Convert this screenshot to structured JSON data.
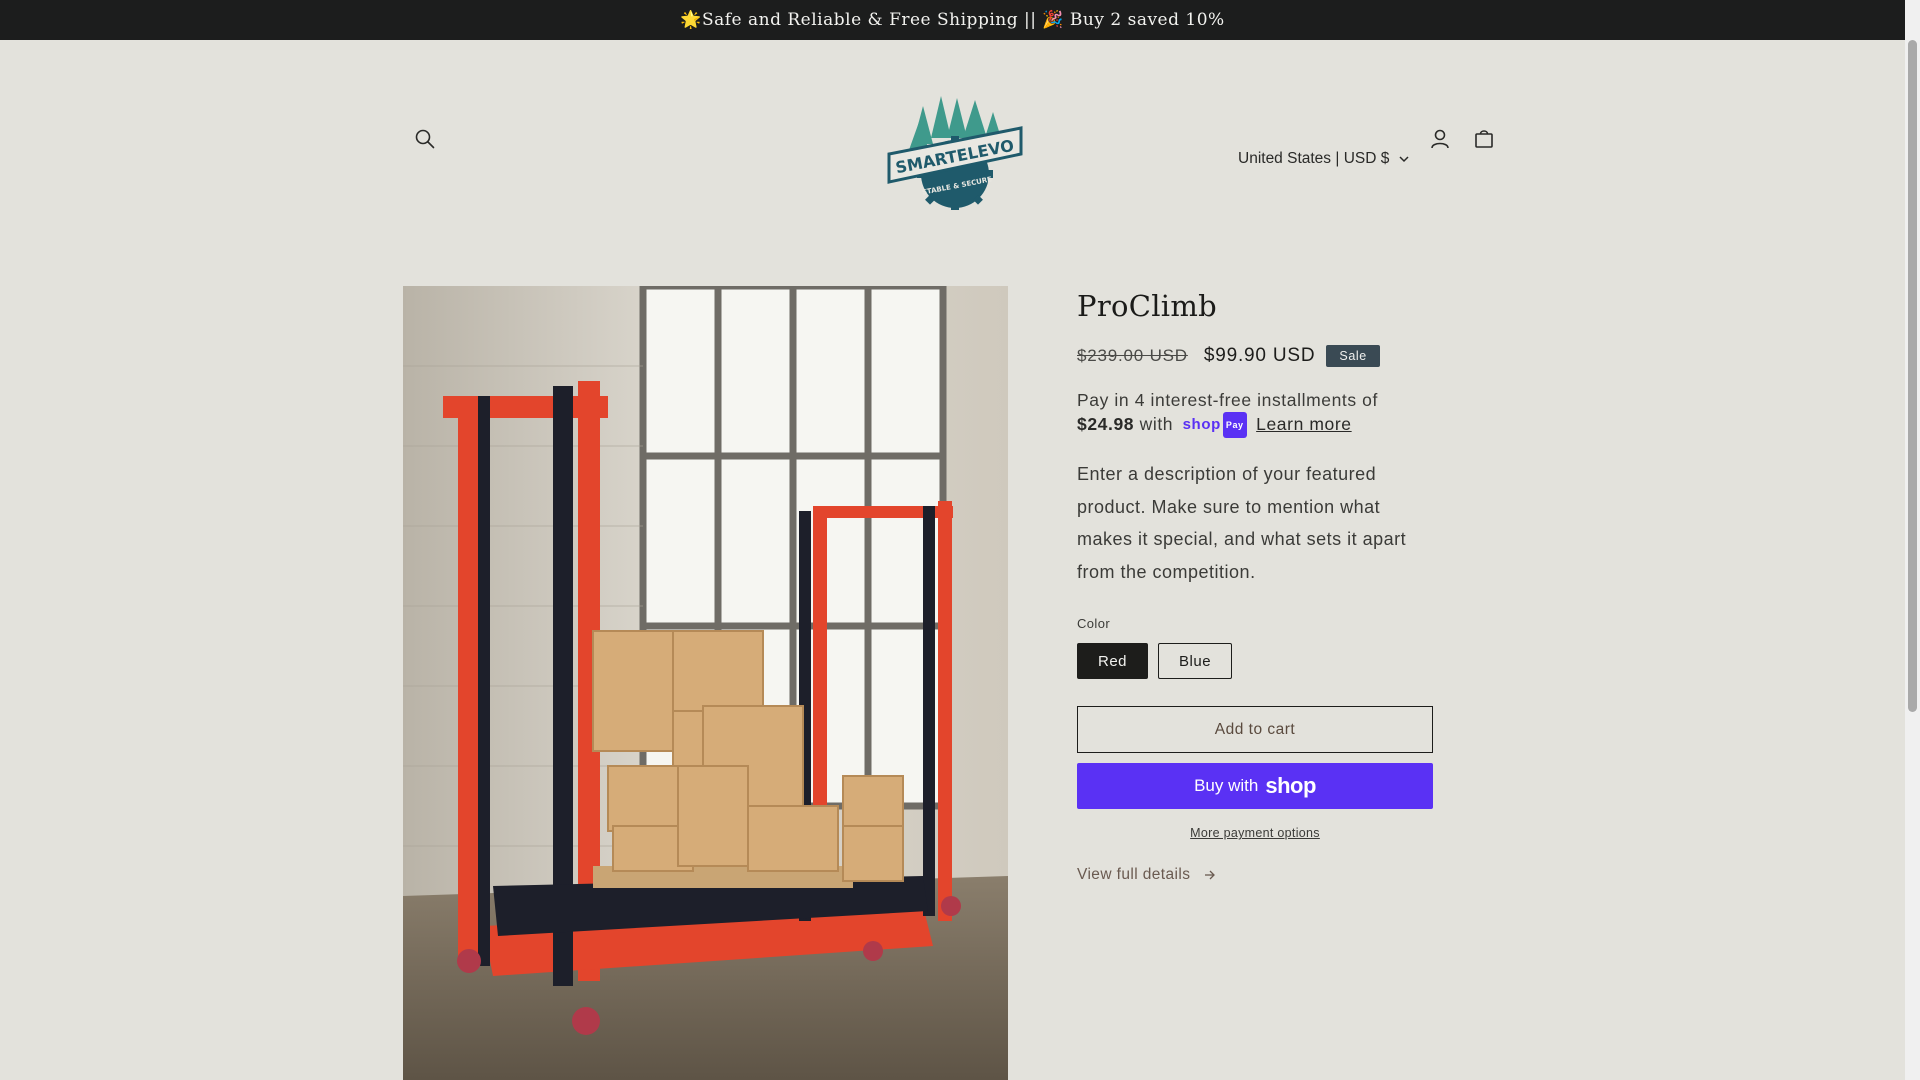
{
  "announcement": {
    "text": "🌟Safe and Reliable & Free Shipping || 🎉 Buy 2 saved 10%"
  },
  "header": {
    "logo_text": "SMARTELEVO",
    "logo_tagline": "STABLE & SECURE",
    "country_selector": "United States | USD $",
    "icons": [
      "search-icon",
      "account-icon",
      "cart-icon"
    ]
  },
  "product": {
    "title": "ProClimb",
    "price_regular": "$239.00 USD",
    "price_sale": "$99.90 USD",
    "sale_badge": "Sale",
    "installments": {
      "prefix": "Pay in 4 interest-free installments of",
      "amount": "$24.98",
      "with": "with",
      "shop_pay_pill": "Pay",
      "shop_pay_word": "shop",
      "learn_more": "Learn more"
    },
    "description": "Enter a description of your featured product. Make sure to mention what makes it special, and what sets it apart from the competition.",
    "color_label": "Color",
    "color_options": [
      "Red",
      "Blue"
    ],
    "selected_color": "Red",
    "add_to_cart": "Add to cart",
    "buy_now_prefix": "Buy with",
    "buy_now_brand": "shop",
    "more_payment_options": "More payment options",
    "view_full_details": "View full details"
  },
  "colors": {
    "background": "#e3e2dc",
    "announcement_bg": "#1c1d1d",
    "sale_badge": "#3a4a54",
    "shop_pay": "#5a31f4",
    "logo_teal": "#2e6d78"
  }
}
